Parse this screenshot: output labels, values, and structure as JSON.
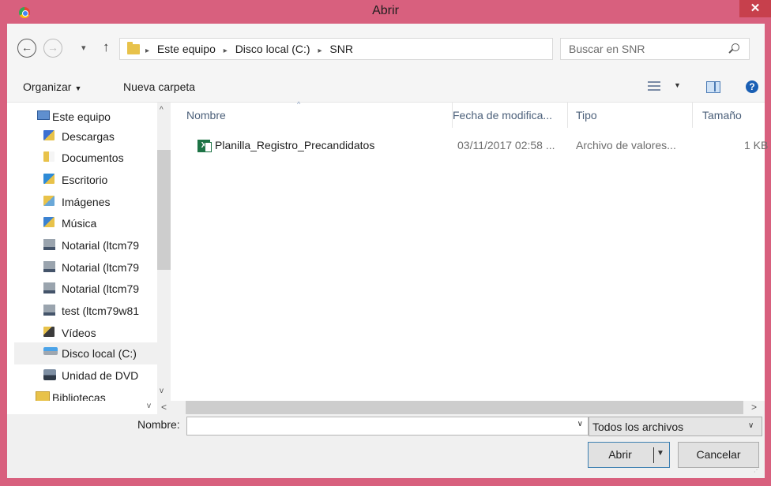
{
  "window": {
    "title": "Abrir",
    "close_glyph": "✕"
  },
  "address_bar": {
    "back_glyph": "←",
    "forward_glyph": "→",
    "recent_glyph": "▾",
    "up_glyph": "↑",
    "breadcrumb": [
      "Este equipo",
      "Disco local (C:)",
      "SNR"
    ],
    "separator_glyph": "▸",
    "dropdown_glyph": "∨",
    "refresh_glyph": "↻"
  },
  "search": {
    "placeholder": "Buscar en SNR"
  },
  "toolbar": {
    "organize": "Organizar",
    "organize_caret": "▼",
    "new_folder": "Nueva carpeta",
    "view_caret": "▼",
    "help": "?"
  },
  "nav_pane": {
    "items": [
      {
        "label": "Este equipo",
        "icon": "computer-icon"
      },
      {
        "label": "Descargas",
        "icon": "downloads-folder-icon"
      },
      {
        "label": "Documentos",
        "icon": "documents-folder-icon"
      },
      {
        "label": "Escritorio",
        "icon": "desktop-folder-icon"
      },
      {
        "label": "Imágenes",
        "icon": "pictures-folder-icon"
      },
      {
        "label": "Música",
        "icon": "music-folder-icon"
      },
      {
        "label": "Notarial (ltcm79",
        "icon": "network-drive-icon"
      },
      {
        "label": "Notarial (ltcm79",
        "icon": "network-drive-icon"
      },
      {
        "label": "Notarial (ltcm79",
        "icon": "network-drive-icon"
      },
      {
        "label": "test (ltcm79w81",
        "icon": "network-drive-icon"
      },
      {
        "label": "Vídeos",
        "icon": "videos-folder-icon"
      },
      {
        "label": "Disco local (C:)",
        "icon": "local-disk-icon",
        "selected": true
      },
      {
        "label": "Unidad de DVD",
        "icon": "dvd-drive-icon"
      },
      {
        "label": "Bibliotecas",
        "icon": "libraries-icon"
      }
    ],
    "scroll_up": "^",
    "scroll_down": "v"
  },
  "file_list": {
    "columns": [
      "Nombre",
      "Fecha de modifica...",
      "Tipo",
      "Tamaño"
    ],
    "sort_indicator": "^",
    "files": [
      {
        "name": "Planilla_Registro_Precandidatos",
        "date": "03/11/2017 02:58 ...",
        "type": "Archivo de valores...",
        "size": "1 KB",
        "icon": "excel-csv-icon"
      }
    ],
    "hscroll_left": "<",
    "hscroll_right": ">"
  },
  "bottom": {
    "filename_label": "Nombre:",
    "filename_value": "",
    "filename_dropdown": "∨",
    "filter_value": "Todos los archivos",
    "filter_dropdown": "∨",
    "open_button": "Abrir",
    "open_dropdown": "▼",
    "cancel_button": "Cancelar"
  },
  "colors": {
    "frame": "#d8607e",
    "close_button": "#c7404c",
    "selection": "#f0f0f0"
  }
}
